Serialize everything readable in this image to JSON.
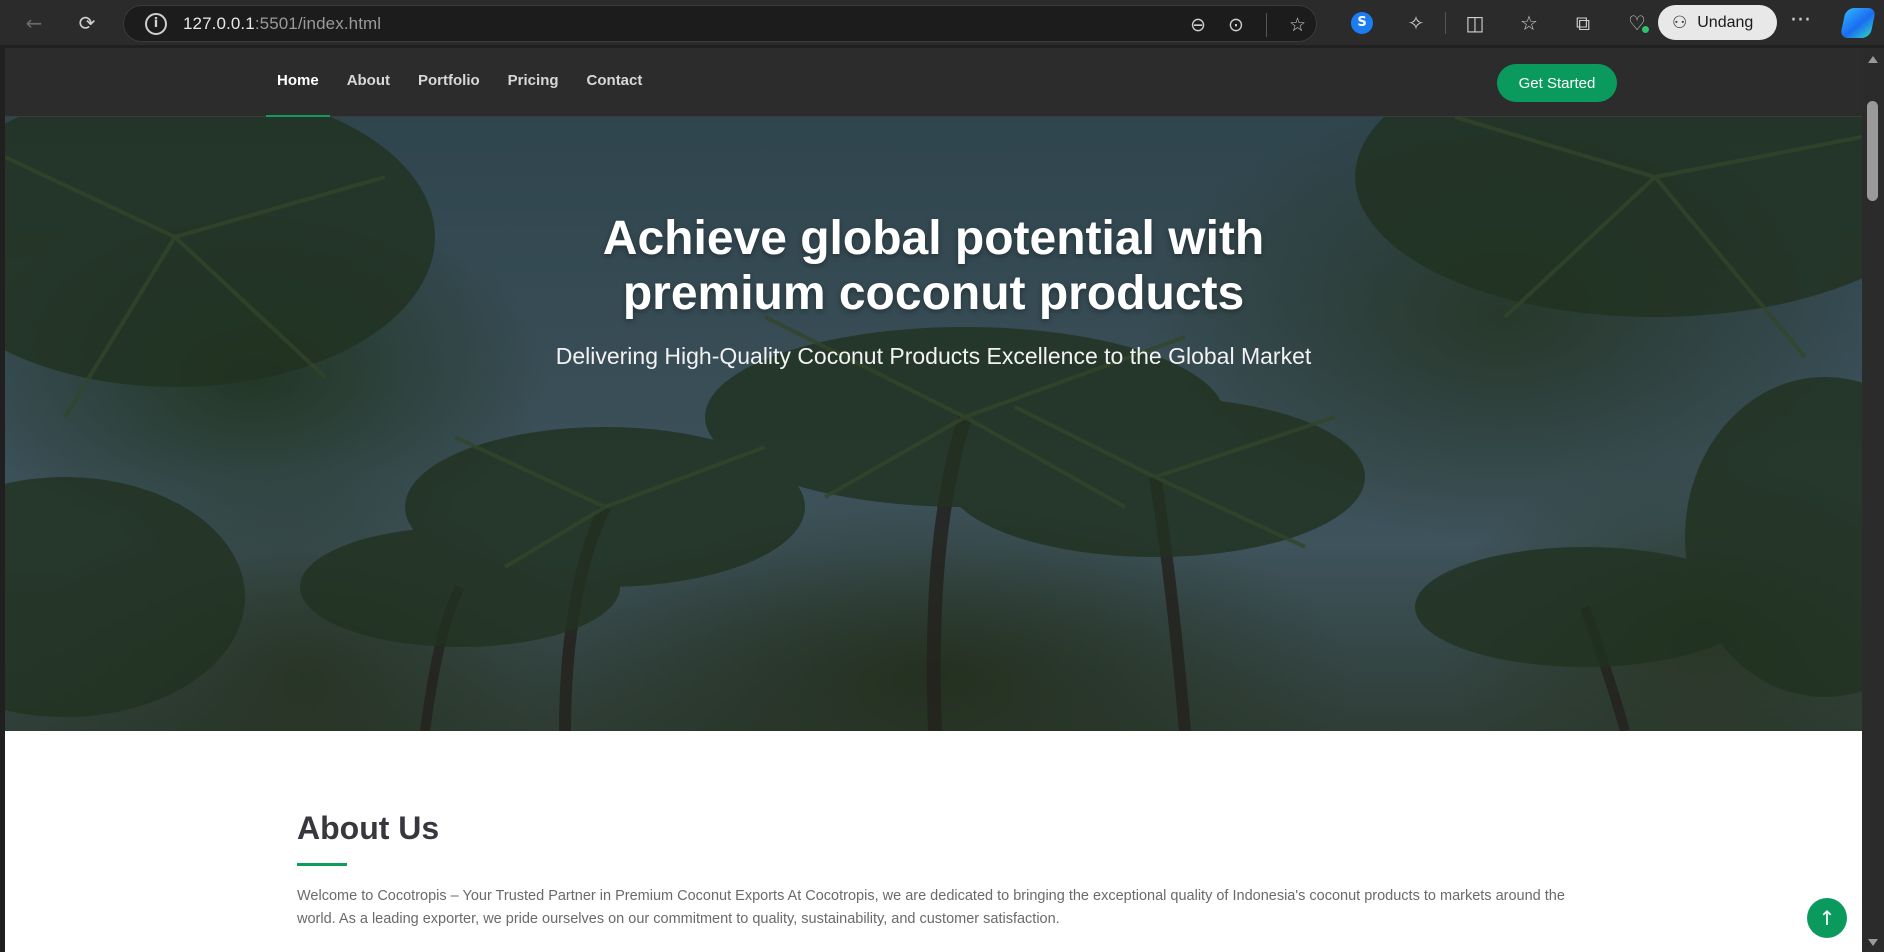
{
  "browser": {
    "url_host": "127.0.0.1",
    "url_rest": ":5501/index.html",
    "back_icon": "arrow-left-icon",
    "reload_icon": "reload-icon",
    "profile_button_label": "Undang"
  },
  "site": {
    "nav": [
      {
        "label": "Home",
        "active": true
      },
      {
        "label": "About",
        "active": false
      },
      {
        "label": "Portfolio",
        "active": false
      },
      {
        "label": "Pricing",
        "active": false
      },
      {
        "label": "Contact",
        "active": false
      }
    ],
    "cta_label": "Get Started",
    "accent_color": "#0b9a5d"
  },
  "hero": {
    "title_line1": "Achieve global potential with",
    "title_line2": "premium coconut products",
    "subtitle": "Delivering High-Quality Coconut Products Excellence to the Global Market"
  },
  "about": {
    "title": "About Us",
    "text": "Welcome to Cocotropis – Your Trusted Partner in Premium Coconut Exports At Cocotropis, we are dedicated to bringing the exceptional quality of Indonesia's coconut products to markets around the world. As a leading exporter, we pride ourselves on our commitment to quality, sustainability, and customer satisfaction."
  }
}
